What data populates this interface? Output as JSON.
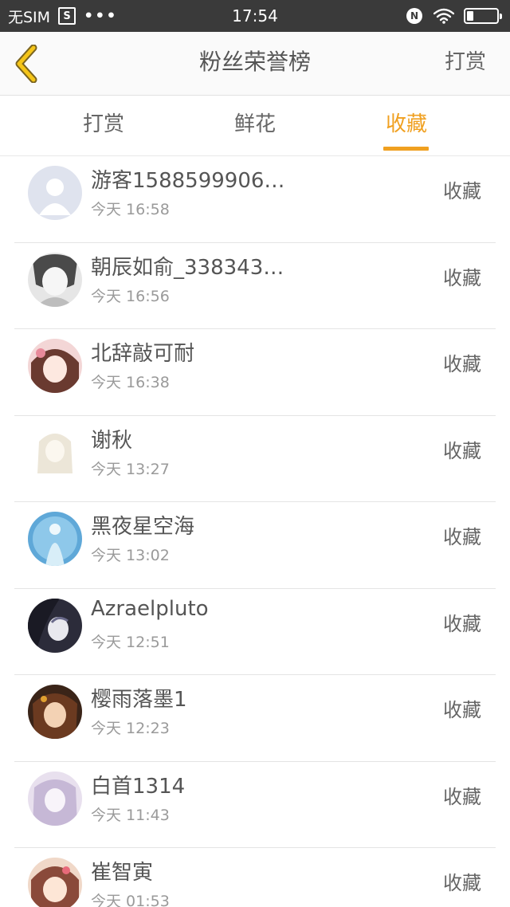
{
  "status_bar": {
    "carrier": "无SIM",
    "sim_icon_label": "S",
    "more": "•••",
    "time": "17:54",
    "nfc_label": "N"
  },
  "header": {
    "title": "粉丝荣誉榜",
    "right_action": "打赏"
  },
  "tabs": [
    {
      "label": "打赏"
    },
    {
      "label": "鲜花"
    },
    {
      "label": "收藏",
      "active": true
    }
  ],
  "colors": {
    "accent": "#f0a020",
    "status_bar": "#3a3a3a"
  },
  "rows": [
    {
      "name": "游客1588599906…",
      "time": "今天 16:58",
      "action": "收藏"
    },
    {
      "name": "朝辰如俞_338343…",
      "time": "今天 16:56",
      "action": "收藏"
    },
    {
      "name": "北辞敲可耐",
      "time": "今天 16:38",
      "action": "收藏"
    },
    {
      "name": "谢秋",
      "time": "今天 13:27",
      "action": "收藏"
    },
    {
      "name": "黑夜星空海",
      "time": "今天 13:02",
      "action": "收藏"
    },
    {
      "name": "Azraelpluto",
      "time": "今天 12:51",
      "action": "收藏"
    },
    {
      "name": "樱雨落墨1",
      "time": "今天 12:23",
      "action": "收藏"
    },
    {
      "name": "白首1314",
      "time": "今天 11:43",
      "action": "收藏"
    },
    {
      "name": "崔智寅",
      "time": "今天 01:53",
      "action": "收藏"
    }
  ]
}
